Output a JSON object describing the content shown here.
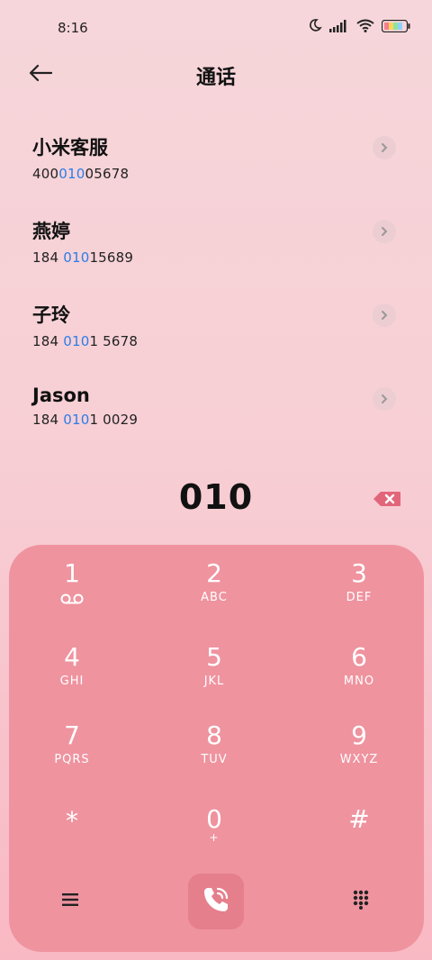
{
  "status_bar": {
    "time": "8:16",
    "icons": [
      "moon-icon",
      "signal-icon",
      "wifi-icon",
      "battery-icon"
    ]
  },
  "header": {
    "title": "通话",
    "back_icon": "arrow-left-icon"
  },
  "contacts": [
    {
      "name": "小米客服",
      "number_pre": "400",
      "number_match": "010",
      "number_post": "05678"
    },
    {
      "name": "燕婷",
      "number_pre": "184 ",
      "number_match": "010",
      "number_post": "15689"
    },
    {
      "name": "子玲",
      "number_pre": "184 ",
      "number_match": "010",
      "number_post": "1 5678"
    },
    {
      "name": "Jason",
      "number_pre": "184 ",
      "number_match": "010",
      "number_post": "1 0029"
    }
  ],
  "dialer": {
    "input_value": "010",
    "keys": [
      {
        "digit": "1",
        "letters": ""
      },
      {
        "digit": "2",
        "letters": "ABC"
      },
      {
        "digit": "3",
        "letters": "DEF"
      },
      {
        "digit": "4",
        "letters": "GHI"
      },
      {
        "digit": "5",
        "letters": "JKL"
      },
      {
        "digit": "6",
        "letters": "MNO"
      },
      {
        "digit": "7",
        "letters": "PQRS"
      },
      {
        "digit": "8",
        "letters": "TUV"
      },
      {
        "digit": "9",
        "letters": "WXYZ"
      },
      {
        "digit": "*",
        "letters": ""
      },
      {
        "digit": "0",
        "letters": "+"
      },
      {
        "digit": "#",
        "letters": ""
      }
    ]
  },
  "colors": {
    "highlight": "#2b7de9",
    "keypad_bg": "#ef939f",
    "call_button_bg": "#e57f8c",
    "backspace": "#e2667a"
  }
}
